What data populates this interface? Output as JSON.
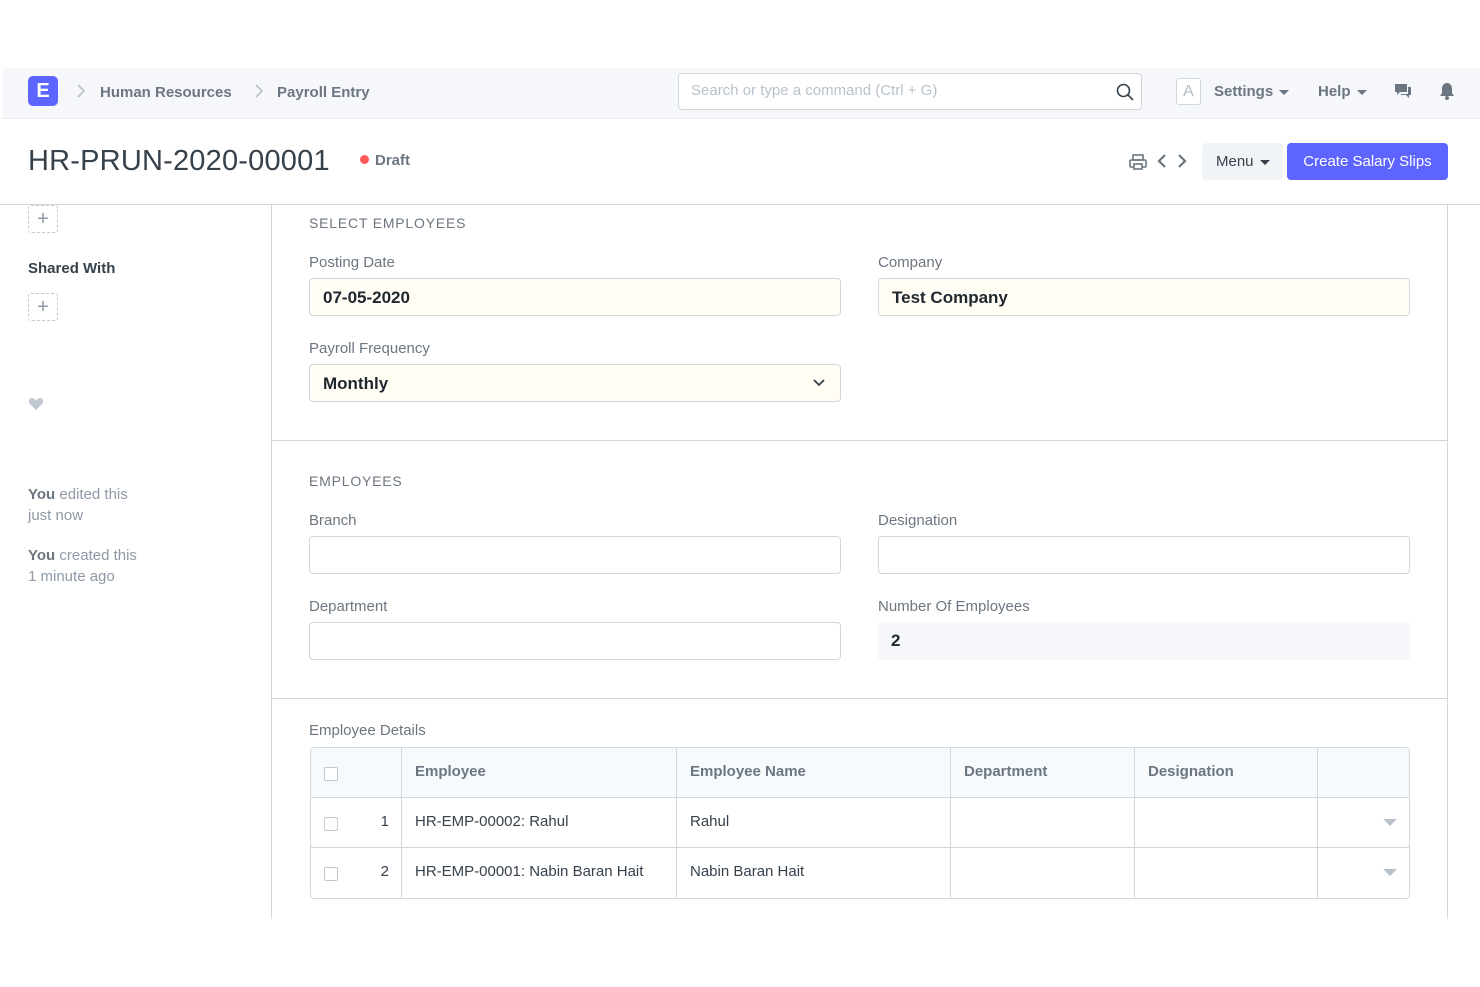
{
  "navbar": {
    "logo_letter": "E",
    "breadcrumbs": [
      "Human Resources",
      "Payroll Entry"
    ],
    "search": {
      "placeholder": "Search or type a command (Ctrl + G)",
      "value": ""
    },
    "avatar_letter": "A",
    "settings_label": "Settings",
    "help_label": "Help",
    "icons": [
      "search-icon",
      "chat-icon",
      "bell-icon"
    ]
  },
  "page": {
    "title": "HR-PRUN-2020-00001",
    "status": "Draft",
    "status_color": "#ff5858",
    "menu_label": "Menu",
    "primary_action": "Create Salary Slips",
    "accent_color": "#5e64ff"
  },
  "sidebar": {
    "add_symbol": "+",
    "shared_with_label": "Shared With",
    "timeline": [
      {
        "actor": "You",
        "action": "edited this",
        "when": "just now"
      },
      {
        "actor": "You",
        "action": "created this",
        "when": "1 minute ago"
      }
    ]
  },
  "form": {
    "select_employees": {
      "heading": "SELECT EMPLOYEES",
      "posting_date": {
        "label": "Posting Date",
        "value": "07-05-2020"
      },
      "company": {
        "label": "Company",
        "value": "Test Company"
      },
      "payroll_frequency": {
        "label": "Payroll Frequency",
        "value": "Monthly"
      }
    },
    "employees": {
      "heading": "EMPLOYEES",
      "branch": {
        "label": "Branch",
        "value": ""
      },
      "designation": {
        "label": "Designation",
        "value": ""
      },
      "department": {
        "label": "Department",
        "value": ""
      },
      "number_of_employees": {
        "label": "Number Of Employees",
        "value": "2"
      }
    },
    "employee_details": {
      "label": "Employee Details",
      "columns": [
        "Employee",
        "Employee Name",
        "Department",
        "Designation"
      ],
      "rows": [
        {
          "idx": "1",
          "employee": "HR-EMP-00002: Rahul",
          "employee_name": "Rahul",
          "department": "",
          "designation": ""
        },
        {
          "idx": "2",
          "employee": "HR-EMP-00001: Nabin Baran Hait",
          "employee_name": "Nabin Baran Hait",
          "department": "",
          "designation": ""
        }
      ]
    }
  }
}
